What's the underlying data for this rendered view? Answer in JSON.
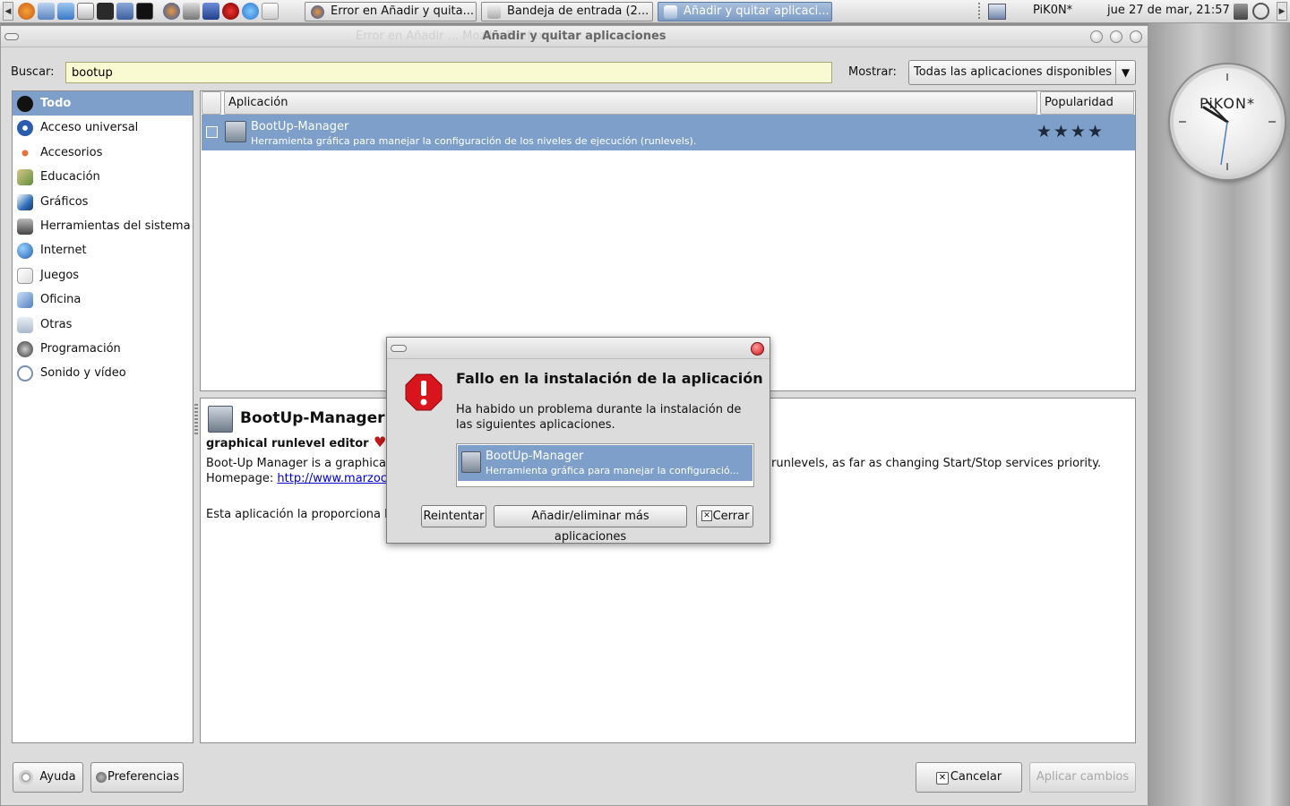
{
  "panel": {
    "tasks": [
      {
        "label": "Error en Añadir y quita..."
      },
      {
        "label": "Bandeja de entrada (2..."
      },
      {
        "label": "Añadir y quitar aplicaci..."
      }
    ],
    "user": "PiK0N*",
    "datetime": "jue 27 de mar, 21:57"
  },
  "clock": {
    "label": "PiKON*"
  },
  "window": {
    "title": "Añadir y quitar aplicaciones",
    "ghost_title": "Error en Añadir ...  Mozilla Firefox",
    "search_label": "Buscar:",
    "search_value": "bootup",
    "show_label": "Mostrar:",
    "show_value": "Todas las aplicaciones disponibles"
  },
  "sidebar": {
    "items": [
      {
        "label": "Todo"
      },
      {
        "label": "Acceso universal"
      },
      {
        "label": "Accesorios"
      },
      {
        "label": "Educación"
      },
      {
        "label": "Gráficos"
      },
      {
        "label": "Herramientas del sistema"
      },
      {
        "label": "Internet"
      },
      {
        "label": "Juegos"
      },
      {
        "label": "Oficina"
      },
      {
        "label": "Otras"
      },
      {
        "label": "Programación"
      },
      {
        "label": "Sonido y vídeo"
      }
    ]
  },
  "list": {
    "columns": {
      "app": "Aplicación",
      "popularity": "Popularidad"
    },
    "rows": [
      {
        "name": "BootUp-Manager",
        "description": "Herramienta gráfica para manejar la configuración de los niveles de ejecución (runlevels).",
        "stars": "★★★★",
        "popularity": 4
      }
    ]
  },
  "details": {
    "title": "BootUp-Manager",
    "subtitle": "graphical runlevel editor",
    "text_start": "Boot-Up Manager is a graphical",
    "text_end": "runlevels, as far as changing Start/Stop services priority.",
    "homepage_label": "Homepage:",
    "homepage_link": "http://www.marzocc",
    "provided": "Esta aplicación la proporciona la"
  },
  "buttons": {
    "help": "Ayuda",
    "preferences": "Preferencias",
    "cancel": "Cancelar",
    "apply": "Aplicar cambios"
  },
  "dialog": {
    "title": "Fallo en la instalación de la aplicación",
    "message": "Ha habido un problema durante la instalación de las siguientes aplicaciones.",
    "item_name": "BootUp-Manager",
    "item_desc": "Herramienta gráfica para manejar la configuració...",
    "retry": "Reintentar",
    "add_remove": "Añadir/eliminar más aplicaciones",
    "close": "Cerrar"
  },
  "colors": {
    "selection": "#7e9fc9",
    "search_bg": "#fafad2",
    "error_red": "#d8141c"
  }
}
